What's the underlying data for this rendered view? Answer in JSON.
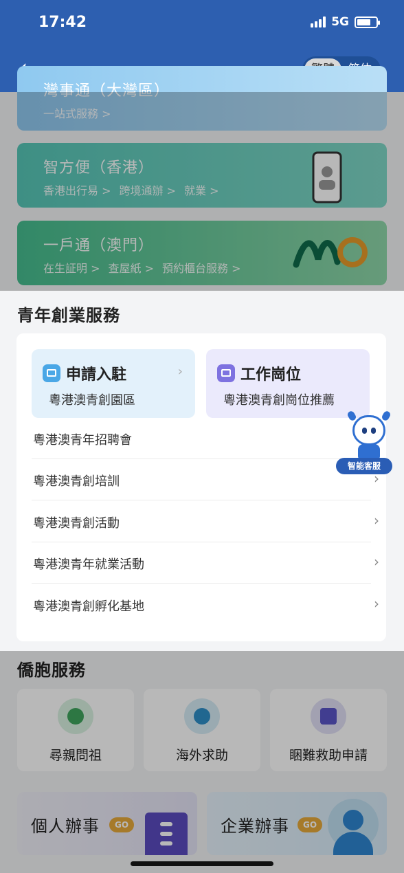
{
  "status": {
    "time": "17:42",
    "network": "5G"
  },
  "nav": {
    "lang_trad": "繁體",
    "lang_simp": "简体"
  },
  "top_cards": [
    {
      "title": "灣事通（大灣區）",
      "links": [
        "一站式服務"
      ]
    },
    {
      "title": "智方便（香港）",
      "links": [
        "香港出行易",
        "跨境通辦",
        "就業"
      ]
    },
    {
      "title": "一戶通（澳門）",
      "links": [
        "在生証明",
        "查屋紙",
        "預約櫃台服務"
      ]
    }
  ],
  "youth": {
    "title": "青年創業服務",
    "tile_a": {
      "title": "申請入駐",
      "subtitle": "粵港澳青創園區"
    },
    "tile_b": {
      "title": "工作崗位",
      "subtitle": "粵港澳青創崗位推薦"
    },
    "rows": [
      "粵港澳青年招聘會",
      "粵港澳青創培訓",
      "粵港澳青創活動",
      "粵港澳青年就業活動",
      "粵港澳青創孵化基地"
    ]
  },
  "assistant": {
    "label": "智能客服"
  },
  "overseas": {
    "title": "僑胞服務",
    "services": [
      "尋親問祖",
      "海外求助",
      "睏難救助申請"
    ]
  },
  "business": {
    "personal": "個人辦事",
    "enterprise": "企業辦事",
    "go": "GO"
  }
}
